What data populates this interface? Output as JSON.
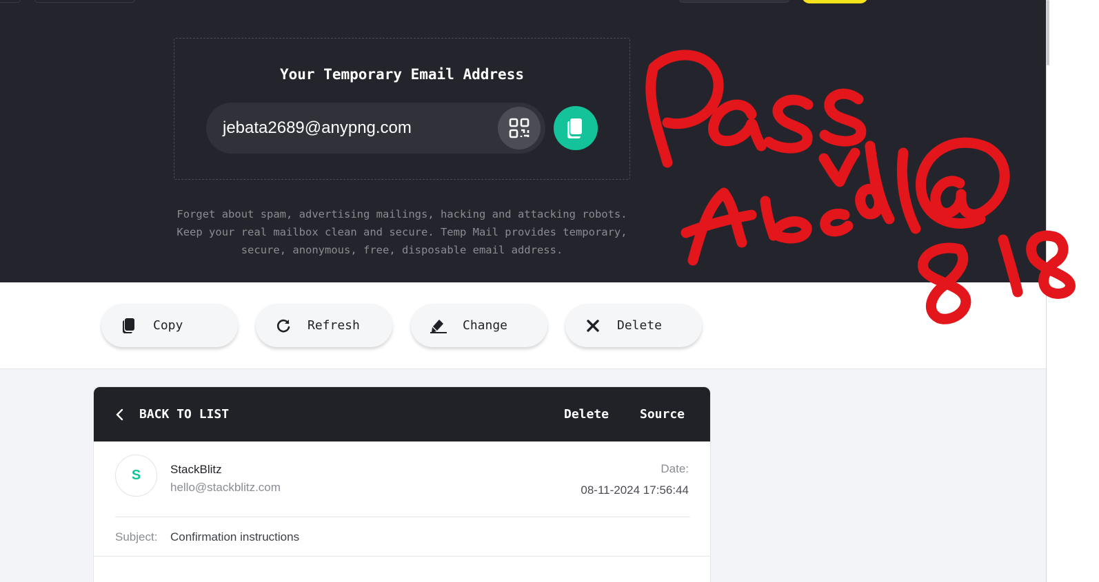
{
  "hero": {
    "title": "Your Temporary Email Address",
    "email": "jebata2689@anypng.com",
    "qr_icon": "qr-code-icon",
    "copy_icon": "copy-icon",
    "description": [
      "Forget about spam, advertising mailings, hacking and attacking robots.",
      "Keep your real mailbox clean and secure. Temp Mail provides temporary,",
      "secure, anonymous, free, disposable email address."
    ]
  },
  "actions": {
    "copy": "Copy",
    "refresh": "Refresh",
    "change": "Change",
    "delete": "Delete"
  },
  "message": {
    "back_label": "BACK TO LIST",
    "delete_label": "Delete",
    "source_label": "Source",
    "avatar_letter": "S",
    "sender_name": "StackBlitz",
    "sender_email": "hello@stackblitz.com",
    "date_label": "Date:",
    "date_value": "08-11-2024 17:56:44",
    "subject_label": "Subject:",
    "subject_value": "Confirmation instructions"
  },
  "colors": {
    "hero_bg": "#24252c",
    "accent_green": "#14c39a",
    "accent_yellow": "#f5e21b",
    "annotation_red": "#e3161b"
  }
}
